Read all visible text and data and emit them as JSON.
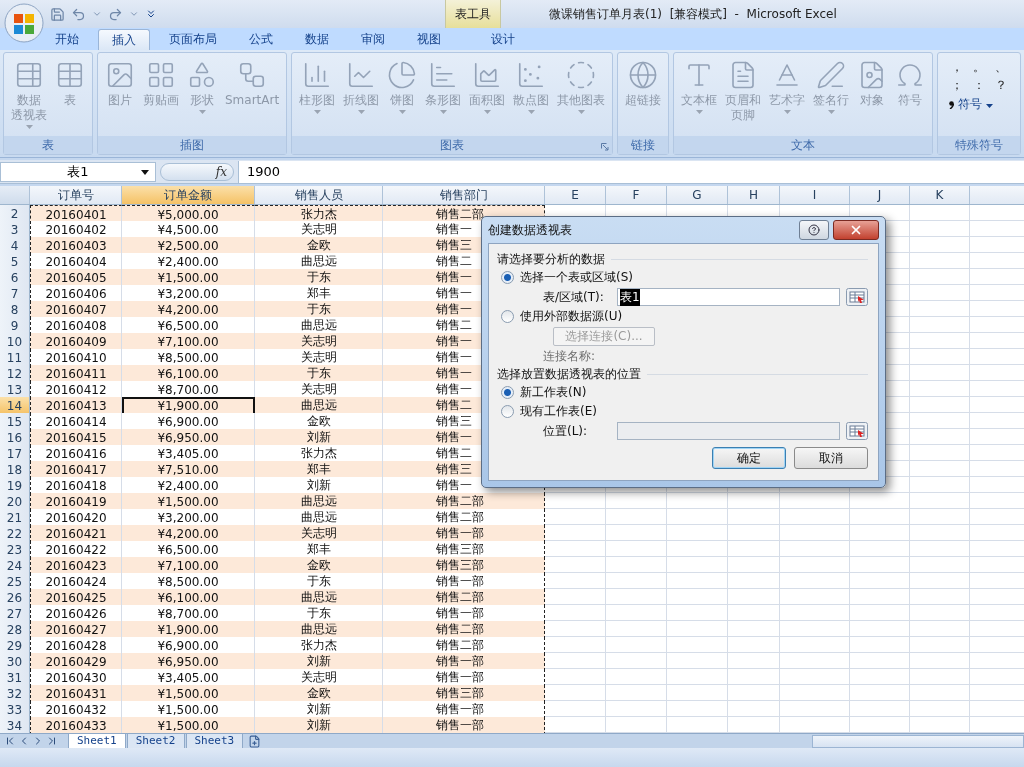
{
  "window": {
    "title": "微课销售订单月表(1)  [兼容模式]  -  Microsoft Excel"
  },
  "context_tab_group": "表工具",
  "tabs": [
    {
      "label": "开始",
      "selected": false,
      "kind": "normal"
    },
    {
      "label": "插入",
      "selected": true,
      "kind": "normal"
    },
    {
      "label": "页面布局",
      "selected": false,
      "kind": "normal"
    },
    {
      "label": "公式",
      "selected": false,
      "kind": "normal"
    },
    {
      "label": "数据",
      "selected": false,
      "kind": "normal"
    },
    {
      "label": "审阅",
      "selected": false,
      "kind": "normal"
    },
    {
      "label": "视图",
      "selected": false,
      "kind": "normal"
    },
    {
      "label": "设计",
      "selected": false,
      "kind": "contextual"
    }
  ],
  "ribbon": {
    "groups": [
      {
        "label": "表",
        "disabled": true,
        "launcher": false,
        "buttons": [
          {
            "lines": [
              "数据",
              "透视表"
            ],
            "dropdown": true
          },
          {
            "lines": [
              "表"
            ],
            "dropdown": false
          }
        ]
      },
      {
        "label": "插图",
        "disabled": true,
        "launcher": false,
        "buttons": [
          {
            "lines": [
              "图片"
            ],
            "dropdown": false
          },
          {
            "lines": [
              "剪贴画"
            ],
            "dropdown": false
          },
          {
            "lines": [
              "形状"
            ],
            "dropdown": true
          },
          {
            "lines": [
              "SmartArt"
            ],
            "dropdown": false
          }
        ]
      },
      {
        "label": "图表",
        "disabled": true,
        "launcher": true,
        "buttons": [
          {
            "lines": [
              "柱形图"
            ],
            "dropdown": true
          },
          {
            "lines": [
              "折线图"
            ],
            "dropdown": true
          },
          {
            "lines": [
              "饼图"
            ],
            "dropdown": true
          },
          {
            "lines": [
              "条形图"
            ],
            "dropdown": true
          },
          {
            "lines": [
              "面积图"
            ],
            "dropdown": true
          },
          {
            "lines": [
              "散点图"
            ],
            "dropdown": true
          },
          {
            "lines": [
              "其他图表"
            ],
            "dropdown": true
          }
        ]
      },
      {
        "label": "链接",
        "disabled": true,
        "launcher": false,
        "buttons": [
          {
            "lines": [
              "超链接"
            ],
            "dropdown": false
          }
        ]
      },
      {
        "label": "文本",
        "disabled": true,
        "launcher": false,
        "buttons": [
          {
            "lines": [
              "文本框"
            ],
            "dropdown": true
          },
          {
            "lines": [
              "页眉和",
              "页脚"
            ],
            "dropdown": false
          },
          {
            "lines": [
              "艺术字"
            ],
            "dropdown": true
          },
          {
            "lines": [
              "签名行"
            ],
            "dropdown": true
          },
          {
            "lines": [
              "对象"
            ],
            "dropdown": false
          },
          {
            "lines": [
              "符号"
            ],
            "dropdown": false
          }
        ]
      }
    ],
    "special_symbols": {
      "label": "特殊符号",
      "symbols": [
        "，",
        "。",
        "、",
        "；",
        "：",
        "？"
      ],
      "button": "符号"
    }
  },
  "formula_bar": {
    "name_box": "表1",
    "function_label": "fx",
    "value": "1900"
  },
  "sheet": {
    "column_headers": [
      {
        "label": "订单号",
        "selected": false
      },
      {
        "label": "订单金额",
        "selected": true
      },
      {
        "label": "销售人员",
        "selected": false
      },
      {
        "label": "销售部门",
        "selected": false
      },
      {
        "label": "E",
        "selected": false
      },
      {
        "label": "F",
        "selected": false
      },
      {
        "label": "G",
        "selected": false
      },
      {
        "label": "H",
        "selected": false
      },
      {
        "label": "I",
        "selected": false
      },
      {
        "label": "J",
        "selected": false
      },
      {
        "label": "K",
        "selected": false
      }
    ],
    "rows": [
      {
        "number": "2",
        "order_no": "20160401",
        "amount": "¥5,000.00",
        "salesperson": "张力杰",
        "department": "销售二部",
        "selected": false
      },
      {
        "number": "3",
        "order_no": "20160402",
        "amount": "¥4,500.00",
        "salesperson": "关志明",
        "department": "销售一",
        "selected": false
      },
      {
        "number": "4",
        "order_no": "20160403",
        "amount": "¥2,500.00",
        "salesperson": "金欧",
        "department": "销售三",
        "selected": false
      },
      {
        "number": "5",
        "order_no": "20160404",
        "amount": "¥2,400.00",
        "salesperson": "曲思远",
        "department": "销售二",
        "selected": false
      },
      {
        "number": "6",
        "order_no": "20160405",
        "amount": "¥1,500.00",
        "salesperson": "于东",
        "department": "销售一",
        "selected": false
      },
      {
        "number": "7",
        "order_no": "20160406",
        "amount": "¥3,200.00",
        "salesperson": "郑丰",
        "department": "销售一",
        "selected": false
      },
      {
        "number": "8",
        "order_no": "20160407",
        "amount": "¥4,200.00",
        "salesperson": "于东",
        "department": "销售一",
        "selected": false
      },
      {
        "number": "9",
        "order_no": "20160408",
        "amount": "¥6,500.00",
        "salesperson": "曲思远",
        "department": "销售二",
        "selected": false
      },
      {
        "number": "10",
        "order_no": "20160409",
        "amount": "¥7,100.00",
        "salesperson": "关志明",
        "department": "销售一",
        "selected": false
      },
      {
        "number": "11",
        "order_no": "20160410",
        "amount": "¥8,500.00",
        "salesperson": "关志明",
        "department": "销售一",
        "selected": false
      },
      {
        "number": "12",
        "order_no": "20160411",
        "amount": "¥6,100.00",
        "salesperson": "于东",
        "department": "销售一",
        "selected": false
      },
      {
        "number": "13",
        "order_no": "20160412",
        "amount": "¥8,700.00",
        "salesperson": "关志明",
        "department": "销售一",
        "selected": false
      },
      {
        "number": "14",
        "order_no": "20160413",
        "amount": "¥1,900.00",
        "salesperson": "曲思远",
        "department": "销售二",
        "selected": true
      },
      {
        "number": "15",
        "order_no": "20160414",
        "amount": "¥6,900.00",
        "salesperson": "金欧",
        "department": "销售三",
        "selected": false
      },
      {
        "number": "16",
        "order_no": "20160415",
        "amount": "¥6,950.00",
        "salesperson": "刘新",
        "department": "销售一",
        "selected": false
      },
      {
        "number": "17",
        "order_no": "20160416",
        "amount": "¥3,405.00",
        "salesperson": "张力杰",
        "department": "销售二",
        "selected": false
      },
      {
        "number": "18",
        "order_no": "20160417",
        "amount": "¥7,510.00",
        "salesperson": "郑丰",
        "department": "销售三",
        "selected": false
      },
      {
        "number": "19",
        "order_no": "20160418",
        "amount": "¥2,400.00",
        "salesperson": "刘新",
        "department": "销售一",
        "selected": false
      },
      {
        "number": "20",
        "order_no": "20160419",
        "amount": "¥1,500.00",
        "salesperson": "曲思远",
        "department": "销售二部",
        "selected": false
      },
      {
        "number": "21",
        "order_no": "20160420",
        "amount": "¥3,200.00",
        "salesperson": "曲思远",
        "department": "销售二部",
        "selected": false
      },
      {
        "number": "22",
        "order_no": "20160421",
        "amount": "¥4,200.00",
        "salesperson": "关志明",
        "department": "销售一部",
        "selected": false
      },
      {
        "number": "23",
        "order_no": "20160422",
        "amount": "¥6,500.00",
        "salesperson": "郑丰",
        "department": "销售三部",
        "selected": false
      },
      {
        "number": "24",
        "order_no": "20160423",
        "amount": "¥7,100.00",
        "salesperson": "金欧",
        "department": "销售三部",
        "selected": false
      },
      {
        "number": "25",
        "order_no": "20160424",
        "amount": "¥8,500.00",
        "salesperson": "于东",
        "department": "销售一部",
        "selected": false
      },
      {
        "number": "26",
        "order_no": "20160425",
        "amount": "¥6,100.00",
        "salesperson": "曲思远",
        "department": "销售二部",
        "selected": false
      },
      {
        "number": "27",
        "order_no": "20160426",
        "amount": "¥8,700.00",
        "salesperson": "于东",
        "department": "销售一部",
        "selected": false
      },
      {
        "number": "28",
        "order_no": "20160427",
        "amount": "¥1,900.00",
        "salesperson": "曲思远",
        "department": "销售二部",
        "selected": false
      },
      {
        "number": "29",
        "order_no": "20160428",
        "amount": "¥6,900.00",
        "salesperson": "张力杰",
        "department": "销售二部",
        "selected": false
      },
      {
        "number": "30",
        "order_no": "20160429",
        "amount": "¥6,950.00",
        "salesperson": "刘新",
        "department": "销售一部",
        "selected": false
      },
      {
        "number": "31",
        "order_no": "20160430",
        "amount": "¥3,405.00",
        "salesperson": "关志明",
        "department": "销售一部",
        "selected": false
      },
      {
        "number": "32",
        "order_no": "20160431",
        "amount": "¥1,500.00",
        "salesperson": "金欧",
        "department": "销售三部",
        "selected": false
      },
      {
        "number": "33",
        "order_no": "20160432",
        "amount": "¥1,500.00",
        "salesperson": "刘新",
        "department": "销售一部",
        "selected": false
      },
      {
        "number": "34",
        "order_no": "20160433",
        "amount": "¥1,500.00",
        "salesperson": "刘新",
        "department": "销售一部",
        "selected": false
      }
    ]
  },
  "sheet_tabs": [
    {
      "label": "Sheet1",
      "selected": true
    },
    {
      "label": "Sheet2",
      "selected": false
    },
    {
      "label": "Sheet3",
      "selected": false
    }
  ],
  "dialog": {
    "title": "创建数据透视表",
    "source_heading": "请选择要分析的数据",
    "source_options": [
      {
        "label": "选择一个表或区域(S)",
        "selected": true
      },
      {
        "label": "使用外部数据源(U)",
        "selected": false
      }
    ],
    "range_label": "表/区域(T):",
    "range_value": "表1",
    "connection_button": {
      "label": "选择连接(C)...",
      "disabled": true
    },
    "connection_name_label": {
      "label": "连接名称:",
      "disabled": true
    },
    "location_heading": "选择放置数据透视表的位置",
    "location_options": [
      {
        "label": "新工作表(N)",
        "selected": true
      },
      {
        "label": "现有工作表(E)",
        "selected": false
      }
    ],
    "location_field": {
      "label": "位置(L):",
      "disabled": true
    },
    "buttons": [
      {
        "label": "确定",
        "default": true
      },
      {
        "label": "取消",
        "default": false
      }
    ]
  }
}
